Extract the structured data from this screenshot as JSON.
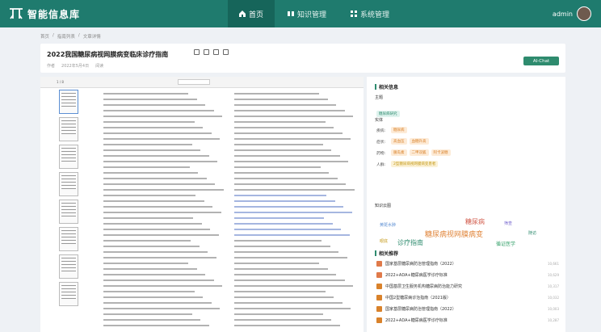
{
  "app": {
    "logo_text": "智能信息库"
  },
  "nav": [
    {
      "label": "首页",
      "icon": "home-icon"
    },
    {
      "label": "知识管理",
      "icon": "book-icon"
    },
    {
      "label": "系统管理",
      "icon": "grid-icon"
    }
  ],
  "user": {
    "name": "admin"
  },
  "breadcrumb": [
    "首页",
    "/",
    "指南列表",
    "/",
    "文章详情"
  ],
  "document": {
    "title": "2022我国糖尿病视网膜病变临床诊疗指南",
    "meta_author": "作者",
    "meta_date": "2022年5月4日",
    "meta_views": "阅读",
    "ai_button": "AI-Chat"
  },
  "viewer": {
    "toolbar_text": "1 / 8"
  },
  "related": {
    "header": "相关信息",
    "topic_label": "主题",
    "topic_tag": "糖尿病研究",
    "entity_label": "实体",
    "entities": [
      {
        "key": "疾病:",
        "tags": [
          "糖尿病"
        ]
      },
      {
        "key": "症状:",
        "tags": [
          "高血压",
          "血糖升高"
        ]
      },
      {
        "key": "药物:",
        "tags": [
          "胰岛素",
          "二甲双胍",
          "阿卡波糖"
        ]
      },
      {
        "key": "人群:",
        "tags": [
          "2型糖尿病视网膜病变患者"
        ]
      }
    ],
    "kg_label": "知识云图",
    "cloud_words": [
      "糖尿病视网膜病变",
      "诊疗指南",
      "糖尿病",
      "黄斑水肿",
      "循证医学",
      "眼底",
      "筛查",
      "随访"
    ],
    "rec_label": "相关推荐",
    "recommendations": [
      {
        "title": "国家基层糖尿病防治管理指南（2022）",
        "count": "10,661",
        "color": "#e07a4a"
      },
      {
        "title": "2022+ADA+糖尿病医学诊疗标准",
        "count": "10,629",
        "color": "#e07a4a"
      },
      {
        "title": "中国基层卫生服务机构糖尿病防治能力研究",
        "count": "10,317",
        "color": "#d9822b"
      },
      {
        "title": "中国2型糖尿病诊治指南（2021版）",
        "count": "10,032",
        "color": "#d9822b"
      },
      {
        "title": "国家基层糖尿病防治管理指南（2022）",
        "count": "10,003",
        "color": "#d9822b"
      },
      {
        "title": "2022+ADA+糖尿病医学诊疗标准",
        "count": "10,287",
        "color": "#d9822b"
      }
    ]
  }
}
